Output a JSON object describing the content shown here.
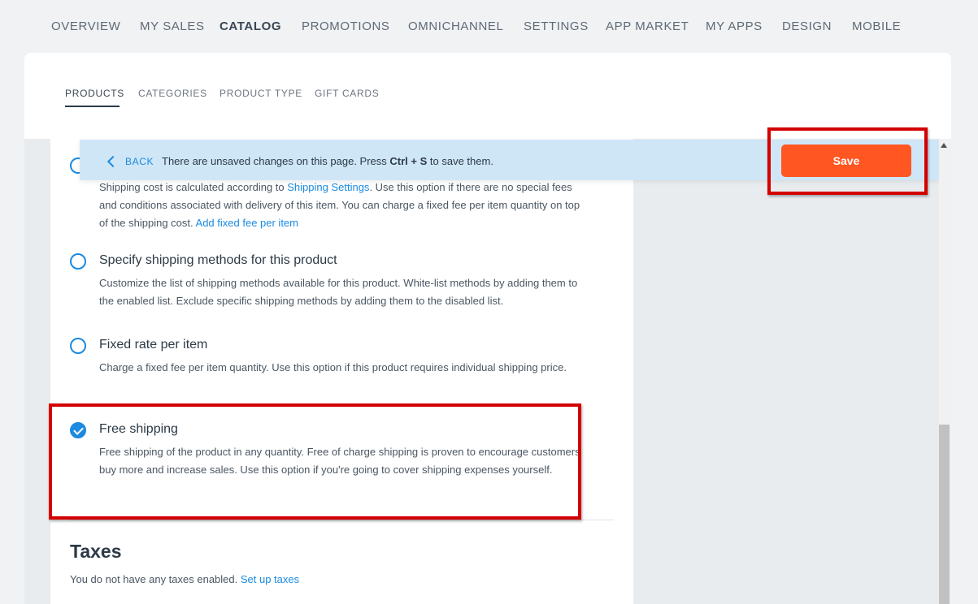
{
  "top_nav": {
    "items": [
      "OVERVIEW",
      "MY SALES",
      "CATALOG",
      "PROMOTIONS",
      "OMNICHANNEL",
      "SETTINGS",
      "APP MARKET",
      "MY APPS",
      "DESIGN",
      "MOBILE"
    ],
    "active": "CATALOG"
  },
  "sub_tabs": {
    "items": [
      "PRODUCTS",
      "CATEGORIES",
      "PRODUCT TYPE",
      "GIFT CARDS"
    ],
    "active": "PRODUCTS"
  },
  "unsaved_bar": {
    "back_label": "BACK",
    "message_prefix": "There are unsaved changes on this page. Press ",
    "shortcut": "Ctrl + S",
    "message_suffix": " to save them.",
    "save_label": "Save"
  },
  "shipping_options": [
    {
      "desc_prefix": "Shipping cost is calculated according to ",
      "desc_link": "Shipping Settings",
      "desc_mid": ". Use this option if there are no special fees and conditions associated with delivery of this item. You can charge a fixed fee per item quantity on top of the shipping cost. ",
      "desc_link2": "Add fixed fee per item",
      "selected": false
    },
    {
      "title": "Specify shipping methods for this product",
      "desc": "Customize the list of shipping methods available for this product. White-list methods by adding them to the enabled list. Exclude specific shipping methods by adding them to the disabled list.",
      "selected": false
    },
    {
      "title": "Fixed rate per item",
      "desc": "Charge a fixed fee per item quantity. Use this option if this product requires individual shipping price.",
      "selected": false
    },
    {
      "title": "Free shipping",
      "desc": "Free shipping of the product in any quantity. Free of charge shipping is proven to encourage customers buy more and increase sales. Use this option if you're going to cover shipping expenses yourself.",
      "selected": true
    }
  ],
  "taxes": {
    "title": "Taxes",
    "desc": "You do not have any taxes enabled. ",
    "link": "Set up taxes"
  },
  "colors": {
    "accent": "#1b8ae0",
    "save": "#ff5622",
    "highlight": "#d40000",
    "unsaved_bg": "#cfe6f7"
  }
}
